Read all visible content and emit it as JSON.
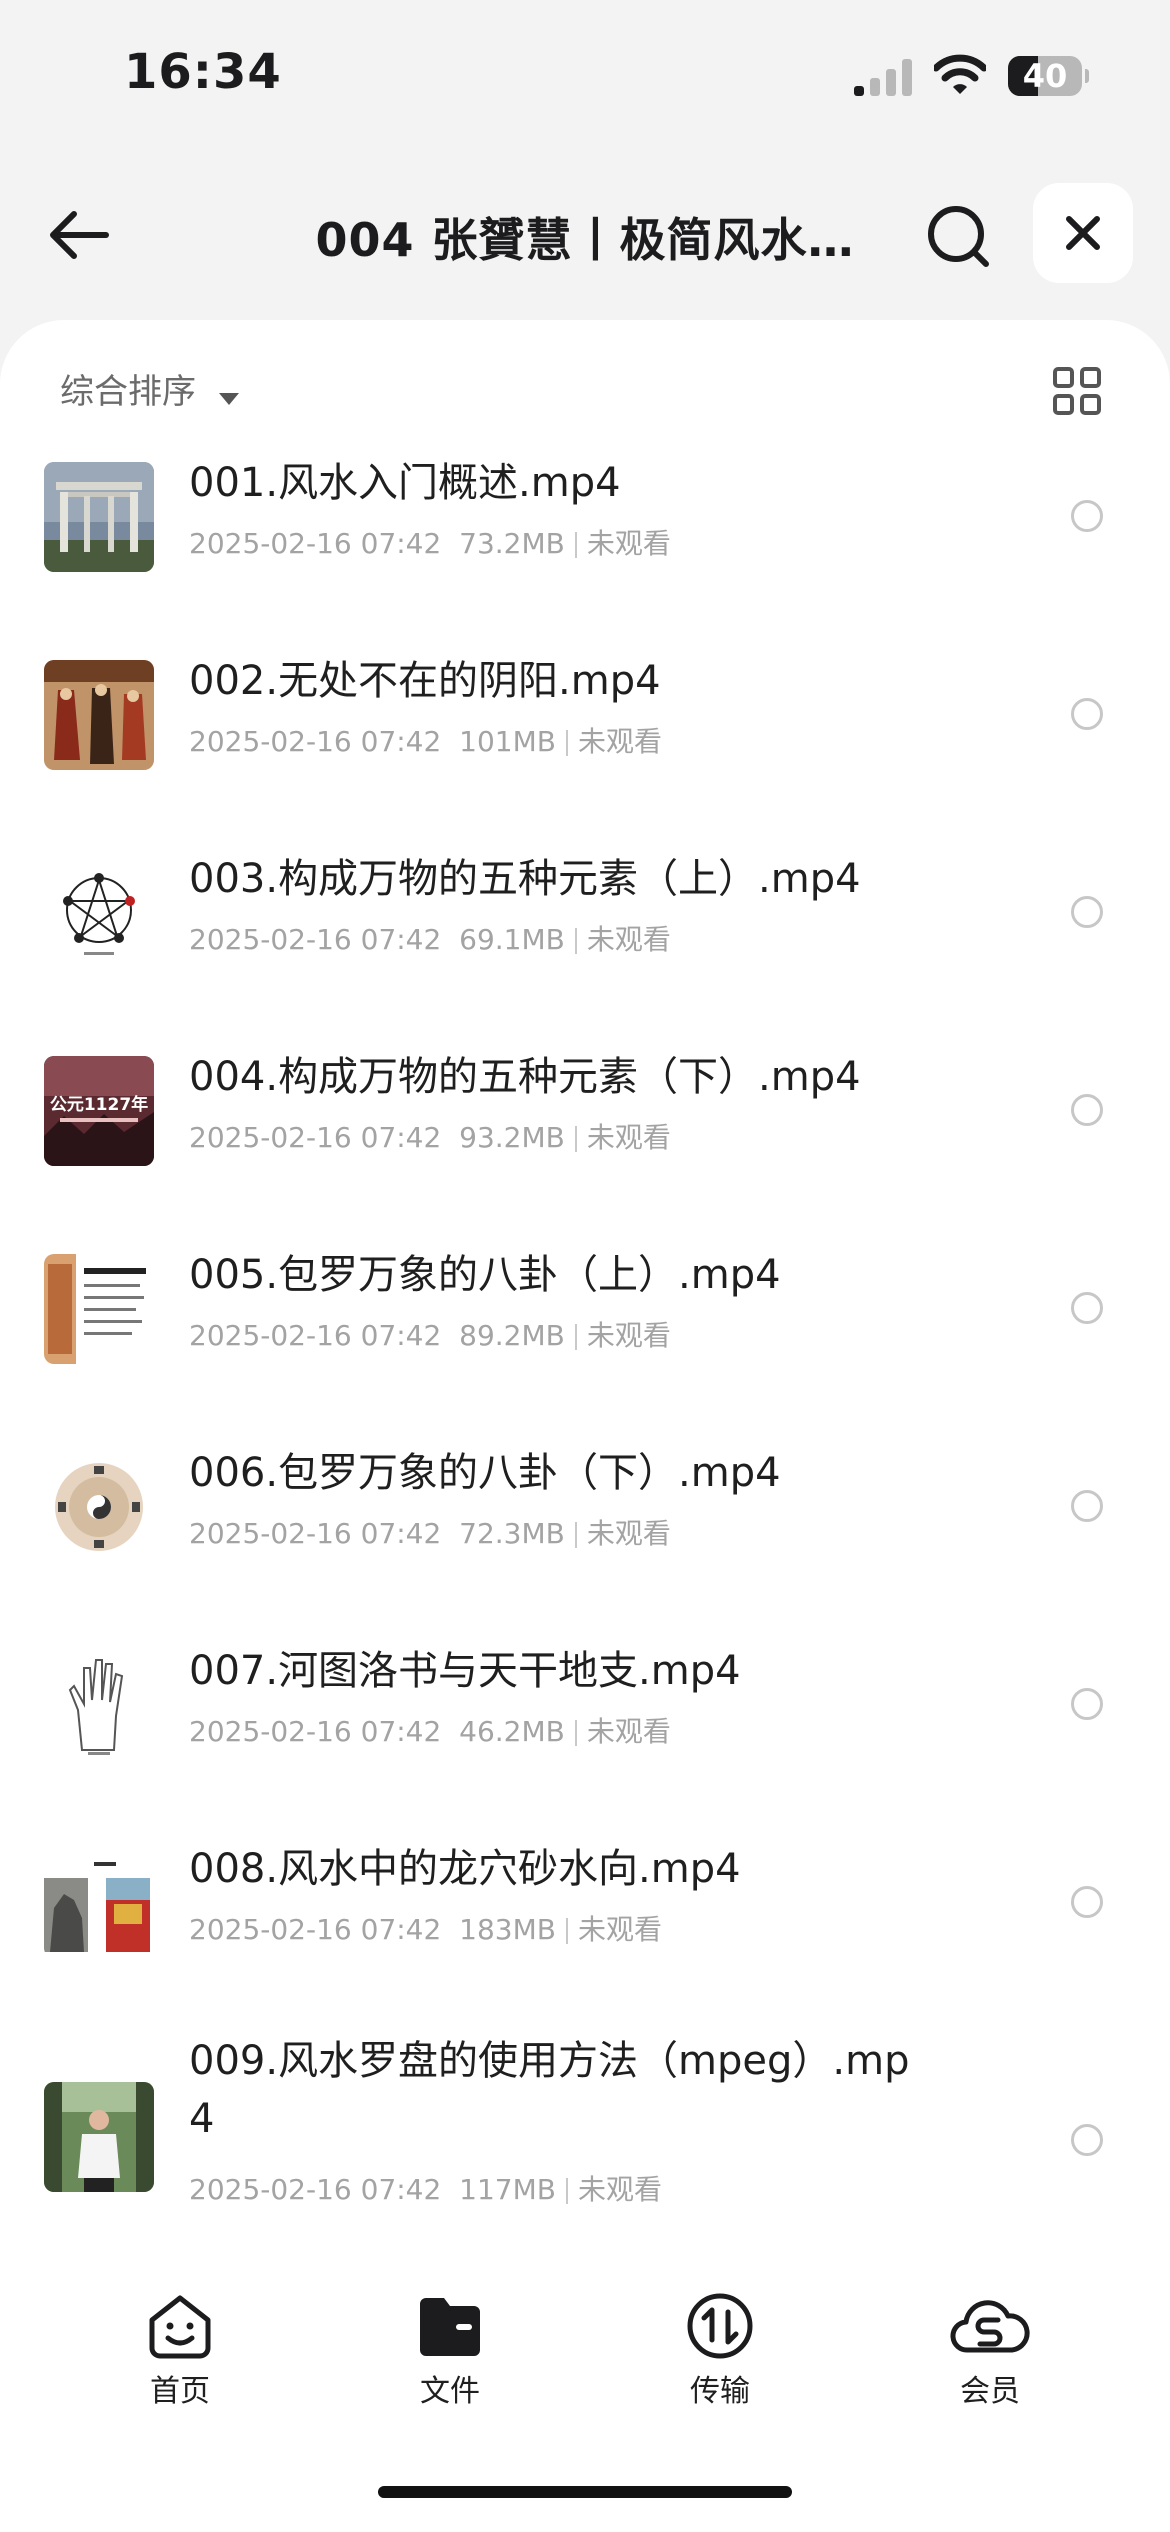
{
  "status_bar": {
    "time": "16:34",
    "battery_level": "40",
    "battery_fraction": 0.4
  },
  "nav": {
    "title": "004 张贇慧丨极简风水…",
    "icons": {
      "back": "arrow-left-icon",
      "search": "search-icon",
      "close": "close-icon"
    }
  },
  "toolbar": {
    "sort_label": "综合排序",
    "view_toggle_icon": "grid-view-icon"
  },
  "files": [
    {
      "name": "001.风水入门概述.mp4",
      "date": "2025-02-16 07:42",
      "size": "73.2MB",
      "status": "未观看"
    },
    {
      "name": "002.无处不在的阴阳.mp4",
      "date": "2025-02-16 07:42",
      "size": "101MB",
      "status": "未观看"
    },
    {
      "name": "003.构成万物的五种元素（上）.mp4",
      "date": "2025-02-16 07:42",
      "size": "69.1MB",
      "status": "未观看"
    },
    {
      "name": "004.构成万物的五种元素（下）.mp4",
      "date": "2025-02-16 07:42",
      "size": "93.2MB",
      "status": "未观看",
      "thumb_text": "公元1127年"
    },
    {
      "name": "005.包罗万象的八卦（上）.mp4",
      "date": "2025-02-16 07:42",
      "size": "89.2MB",
      "status": "未观看"
    },
    {
      "name": "006.包罗万象的八卦（下）.mp4",
      "date": "2025-02-16 07:42",
      "size": "72.3MB",
      "status": "未观看"
    },
    {
      "name": "007.河图洛书与天干地支.mp4",
      "date": "2025-02-16 07:42",
      "size": "46.2MB",
      "status": "未观看"
    },
    {
      "name": "008.风水中的龙穴砂水向.mp4",
      "date": "2025-02-16 07:42",
      "size": "183MB",
      "status": "未观看"
    },
    {
      "name": "009.风水罗盘的使用方法（mpeg）.mp4",
      "date": "2025-02-16 07:42",
      "size": "117MB",
      "status": "未观看"
    }
  ],
  "tabs": [
    {
      "label": "首页",
      "icon": "home-smile-icon"
    },
    {
      "label": "文件",
      "icon": "folder-icon",
      "active": true
    },
    {
      "label": "传输",
      "icon": "transfer-icon"
    },
    {
      "label": "会员",
      "icon": "vip-cloud-icon"
    }
  ]
}
